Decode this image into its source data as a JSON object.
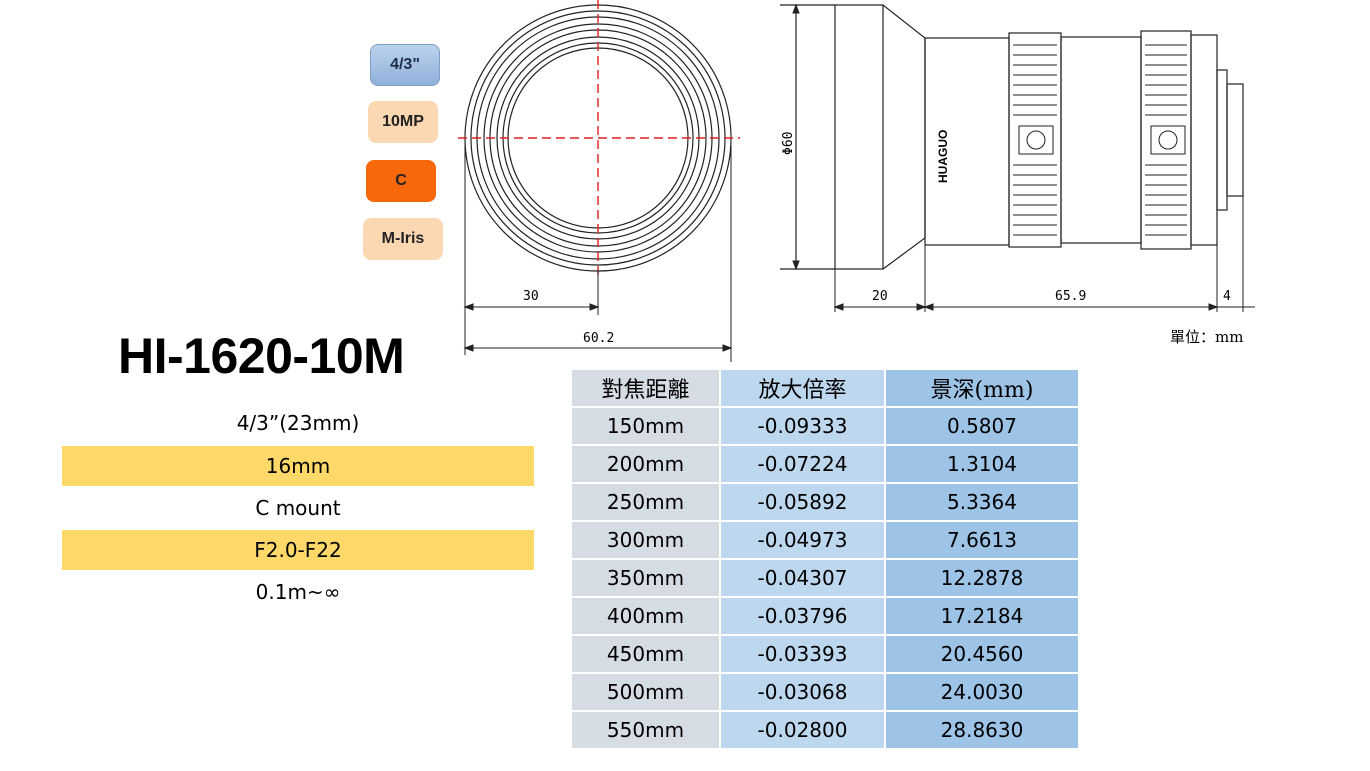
{
  "badges": {
    "format": "4/3\"",
    "resolution": "10MP",
    "mount": "C",
    "iris": "M-Iris"
  },
  "model": "HI-1620-10M",
  "specs": {
    "sensor": "4/3”(23mm)",
    "focal": "16mm",
    "mount": "C mount",
    "aperture": "F2.0-F22",
    "mod": "0.1m~∞"
  },
  "drawing": {
    "front_half_width": "30",
    "front_diameter": "60.2",
    "side_diameter": "Φ60",
    "dim_front": "20",
    "dim_body": "65.9",
    "dim_rear": "4",
    "unit_label": "單位：mm",
    "brand": "HUAGUO"
  },
  "table": {
    "headers": [
      "對焦距離",
      "放大倍率",
      "景深(mm)"
    ],
    "rows": [
      [
        "150mm",
        "-0.09333",
        "0.5807"
      ],
      [
        "200mm",
        "-0.07224",
        "1.3104"
      ],
      [
        "250mm",
        "-0.05892",
        "5.3364"
      ],
      [
        "300mm",
        "-0.04973",
        "7.6613"
      ],
      [
        "350mm",
        "-0.04307",
        "12.2878"
      ],
      [
        "400mm",
        "-0.03796",
        "17.2184"
      ],
      [
        "450mm",
        "-0.03393",
        "20.4560"
      ],
      [
        "500mm",
        "-0.03068",
        "24.0030"
      ],
      [
        "550mm",
        "-0.02800",
        "28.8630"
      ]
    ]
  }
}
